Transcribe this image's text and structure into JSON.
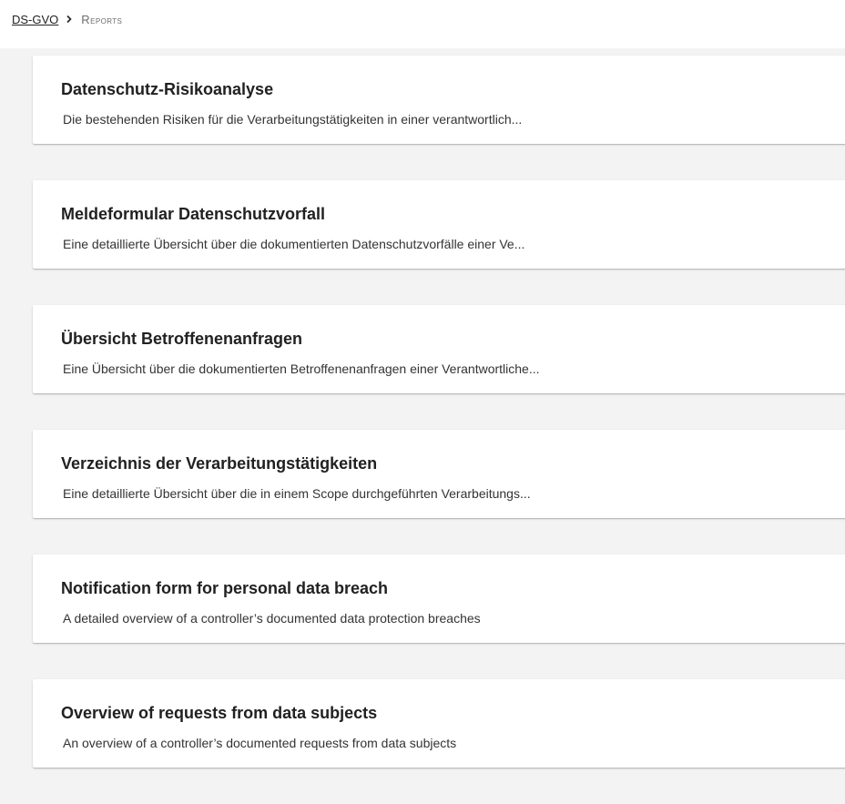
{
  "breadcrumb": {
    "root": "DS-GVO",
    "separator_icon": "chevron-right-icon",
    "current_first": "R",
    "current_rest": "eports"
  },
  "reports": [
    {
      "title": "Datenschutz-Risikoanalyse",
      "description": "Die bestehenden Risiken für die Verarbeitungstätigkeiten in einer verantwortlich..."
    },
    {
      "title": "Meldeformular Datenschutzvorfall",
      "description": "Eine detaillierte Übersicht über die dokumentierten Datenschutzvorfälle einer Ve..."
    },
    {
      "title": "Übersicht Betroffenenanfragen",
      "description": "Eine Übersicht über die dokumentierten Betroffenenanfragen einer Verantwortliche..."
    },
    {
      "title": "Verzeichnis der Verarbeitungstätigkeiten",
      "description": "Eine detaillierte Übersicht über die in einem Scope durchgeführten Verarbeitungs..."
    },
    {
      "title": "Notification form for personal data breach",
      "description": "A detailed overview of a controller’s documented data protection breaches"
    },
    {
      "title": "Overview of requests from data subjects",
      "description": "An overview of a controller’s documented requests from data subjects"
    }
  ]
}
